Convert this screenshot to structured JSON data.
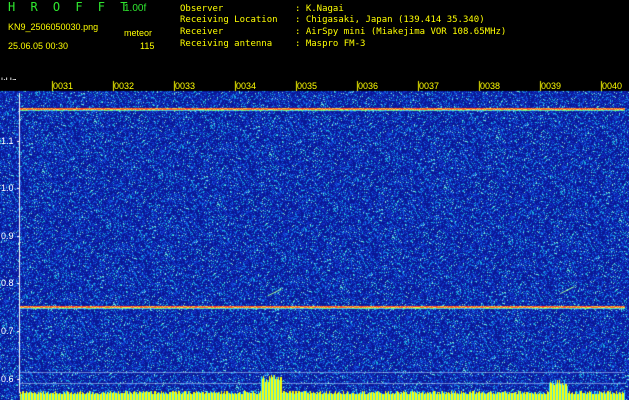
{
  "header": {
    "app_title": "H R O F F T",
    "version": "1.00f",
    "filename": "KN9_2506050030.png",
    "mode": "meteor",
    "datetime": "25.06.05 00:30",
    "count": "115"
  },
  "station": {
    "observer_label": "Observer",
    "observer_value": ": K.Nagai",
    "location_label": "Receiving Location",
    "location_value": ": Chigasaki, Japan (139.414 35.340)",
    "receiver_label": "Receiver",
    "receiver_value": ": AirSpy mini (Miakejima VOR 108.65MHz)",
    "antenna_label": "Receiving antenna",
    "antenna_value": ": Maspro FM-3"
  },
  "colors": {
    "background": "#000000",
    "header_text": "#ffff00",
    "title_text": "#2fe82f",
    "noise_low": "#0a1a9c",
    "signal_line": "#ff3a2a",
    "power_bar": "#ffff00"
  },
  "chart_data": {
    "type": "heatmap",
    "unit_label": "kHz",
    "x_ticks": [
      "0031",
      "0032",
      "0033",
      "0034",
      "0035",
      "0036",
      "0037",
      "0038",
      "0039",
      "0040"
    ],
    "y_ticks": [
      "1.1",
      "1.0",
      "0.9",
      "0.8",
      "0.7",
      "0.6"
    ],
    "ylim": [
      0.57,
      1.2
    ],
    "carrier_lines_khz": [
      1.167,
      0.75
    ],
    "meteor_echoes": [
      {
        "time": "00:34.5",
        "freq_khz": 0.78
      },
      {
        "time": "00:39.3",
        "freq_khz": 0.785
      }
    ]
  }
}
